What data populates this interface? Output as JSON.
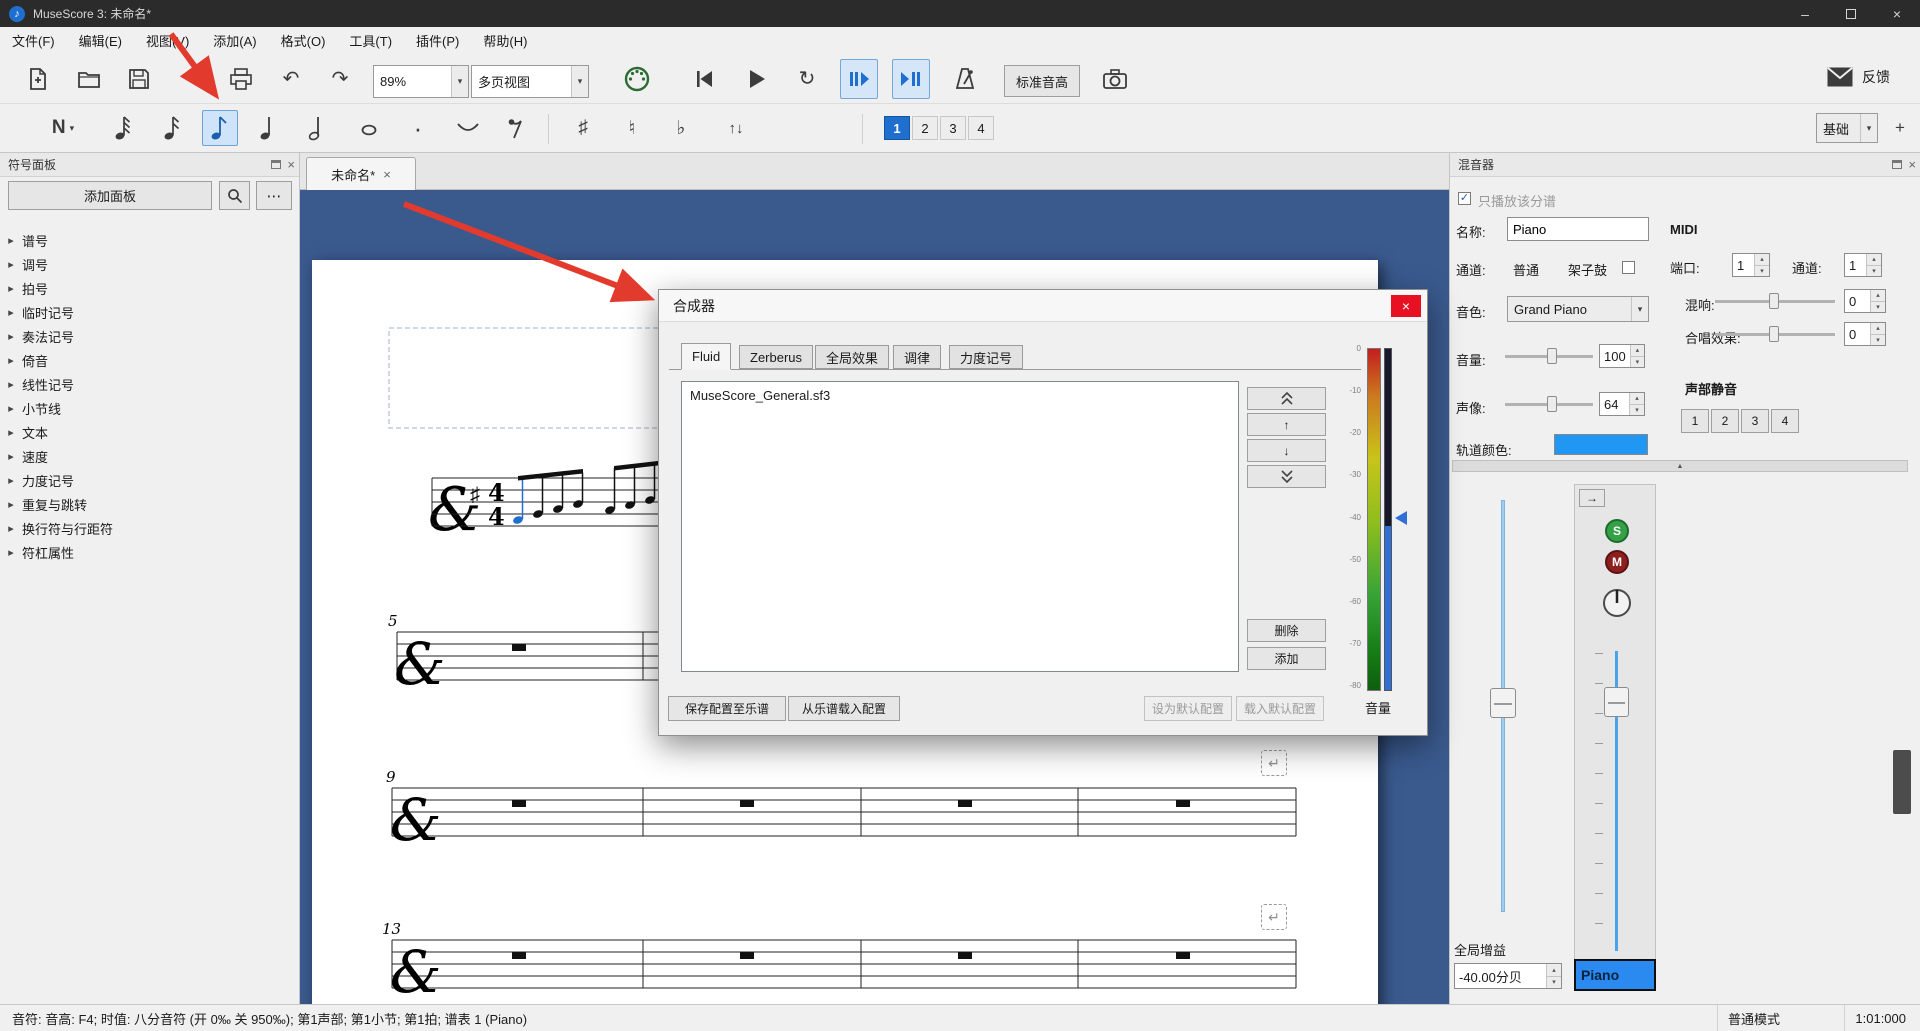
{
  "titlebar": {
    "title": "MuseScore 3: 未命名*"
  },
  "menubar": {
    "items": [
      "文件(F)",
      "编辑(E)",
      "视图(V)",
      "添加(A)",
      "格式(O)",
      "工具(T)",
      "插件(P)",
      "帮助(H)"
    ]
  },
  "toolbar": {
    "zoom": "89%",
    "view_mode": "多页视图",
    "concert_pitch": "标准音高",
    "feedback": "反馈"
  },
  "note_input": {
    "letter": "N",
    "voices": [
      "1",
      "2",
      "3",
      "4"
    ],
    "workspace": "基础",
    "sharp": "♯",
    "natural": "♮",
    "flat": "♭"
  },
  "palette": {
    "title": "符号面板",
    "add_button": "添加面板",
    "items": [
      "谱号",
      "调号",
      "拍号",
      "临时记号",
      "奏法记号",
      "倚音",
      "线性记号",
      "小节线",
      "文本",
      "速度",
      "力度记号",
      "重复与跳转",
      "换行符与行距符",
      "符杠属性"
    ]
  },
  "score": {
    "tab_title": "未命名*",
    "m5": "5",
    "m9": "9",
    "m13": "13",
    "time_top": "4",
    "time_bottom": "4"
  },
  "synth": {
    "title": "合成器",
    "tabs": [
      "Fluid",
      "Zerberus",
      "全局效果",
      "调律",
      "力度记号"
    ],
    "soundfont": "MuseScore_General.sf3",
    "delete": "删除",
    "add": "添加",
    "save_to_score": "保存配置至乐谱",
    "load_from_score": "从乐谱载入配置",
    "set_default": "设为默认配置",
    "load_default": "载入默认配置",
    "meter_label": "音量",
    "meter_ticks": [
      "0",
      "-10",
      "-20",
      "-30",
      "-40",
      "-50",
      "-60",
      "-70",
      "-80"
    ]
  },
  "mixer": {
    "title": "混音器",
    "play_part_only": "只播放该分谱",
    "name_label": "名称:",
    "name_value": "Piano",
    "midi_label": "MIDI",
    "channel_label": "通道:",
    "channel_value": "普通",
    "drumset_label": "架子鼓",
    "port_label": "端口:",
    "port_value": "1",
    "midi_channel_label": "通道:",
    "midi_channel_value": "1",
    "sound_label": "音色:",
    "sound_value": "Grand Piano",
    "reverb_label": "混响:",
    "reverb_value": "0",
    "volume_label": "音量:",
    "volume_value": "100",
    "chorus_label": "合唱效果:",
    "chorus_value": "0",
    "pan_label": "声像:",
    "pan_value": "64",
    "part_mute_label": "声部静音",
    "part_buttons": [
      "1",
      "2",
      "3",
      "4"
    ],
    "track_color_label": "轨道颜色:",
    "master_gain_label": "全局增益",
    "master_gain_value": "-40.00分贝",
    "track_name": "Piano",
    "solo": "S",
    "mute": "M"
  },
  "statusbar": {
    "info": "音符: 音高: F4; 时值: 八分音符 (开 0‰ 关 950‰); 第1声部; 第1小节; 第1拍; 谱表 1 (Piano)",
    "mode": "普通模式",
    "position": "1:01:000"
  },
  "colors": {
    "track_color": "#2196f3",
    "selection": "#1f6fd0",
    "annotation": "#e23b2e"
  },
  "icons": {
    "minimize": "–",
    "close": "×",
    "tab_close": "×",
    "undo": "↶",
    "redo": "↷",
    "loop": "↻",
    "dropdown": "▾",
    "spin_up": "▴",
    "spin_down": "▾",
    "ellipsis": "⋯",
    "tree_arrow": "▸",
    "break": "↵",
    "dot": "·",
    "flip": "↑↓",
    "plus": "+",
    "arrow_right": "→",
    "splitter_up": "▲",
    "up": "↑",
    "down": "↓"
  }
}
